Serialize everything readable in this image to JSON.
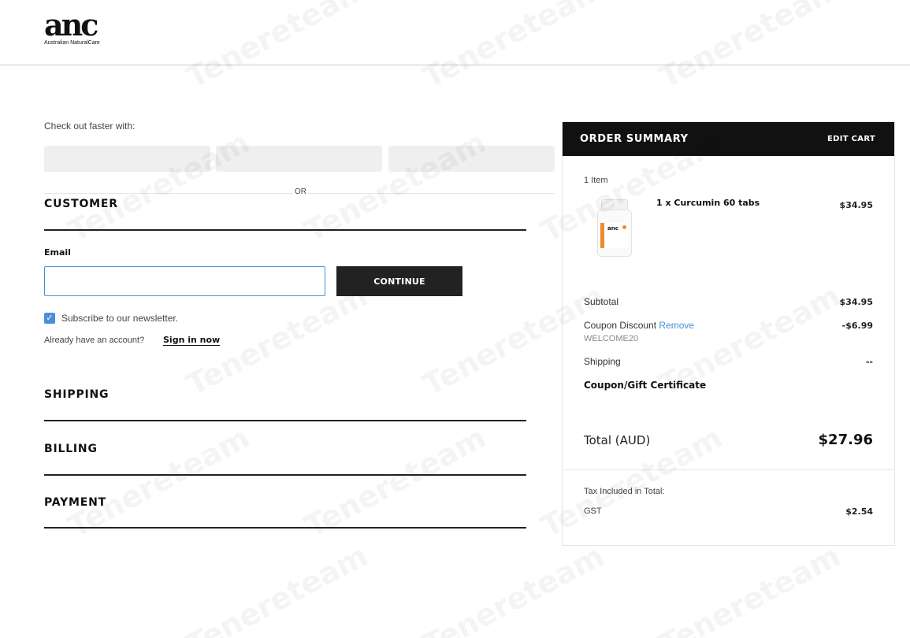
{
  "brand": {
    "logo_text": "anc",
    "logo_subtitle": "Australian NaturalCare"
  },
  "checkout": {
    "faster_label": "Check out faster with:",
    "or_label": "OR",
    "sections": {
      "customer": "CUSTOMER",
      "shipping": "SHIPPING",
      "billing": "BILLING",
      "payment": "PAYMENT"
    },
    "email": {
      "label": "Email",
      "value": "",
      "placeholder": ""
    },
    "continue_label": "CONTINUE",
    "newsletter": {
      "label": "Subscribe to our newsletter.",
      "checked": true
    },
    "account_prompt": "Already have an account?",
    "sign_in_label": "Sign in now"
  },
  "summary": {
    "title": "ORDER SUMMARY",
    "edit_cart_label": "EDIT CART",
    "item_count": "1 Item",
    "item": {
      "name": "1 x Curcumin 60 tabs",
      "price": "$34.95",
      "label_brand": "anc"
    },
    "subtotal_label": "Subtotal",
    "subtotal_value": "$34.95",
    "coupon_label": "Coupon Discount",
    "coupon_remove": "Remove",
    "coupon_value": "-$6.99",
    "coupon_code": "WELCOME20",
    "shipping_label": "Shipping",
    "shipping_value": "--",
    "coupon_cert_label": "Coupon/Gift Certificate",
    "total_label": "Total (AUD)",
    "total_value": "$27.96",
    "tax_label": "Tax Included in Total:",
    "gst_label": "GST",
    "gst_value": "$2.54"
  },
  "watermark": "Tenereteam",
  "colors": {
    "accent": "#4a90d9",
    "dark": "#111111",
    "button_bg": "#222222"
  }
}
